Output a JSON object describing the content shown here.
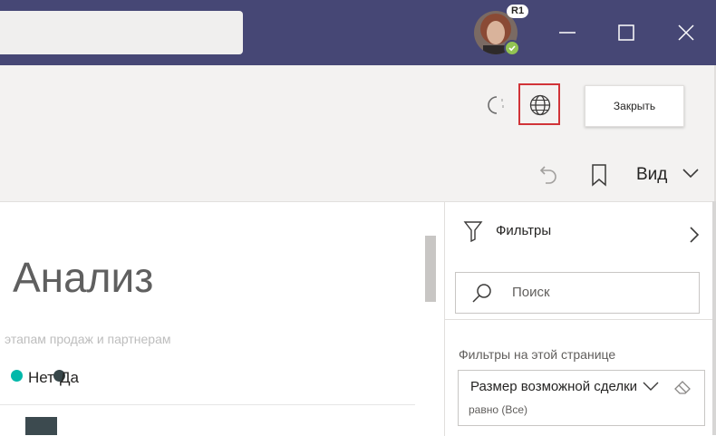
{
  "titlebar": {
    "user_badge": "R1",
    "presence_status": "available",
    "colors": {
      "background": "#464775",
      "search": "#f0efee",
      "presence": "#92c353"
    },
    "window_icons": [
      "minimize-icon",
      "maximize-icon",
      "close-icon"
    ]
  },
  "toolbar": {
    "refresh_icon": "refresh-icon",
    "globe_icon": "globe-icon",
    "close_label": "Закрыть",
    "undo_icon": "undo-icon",
    "bookmark_icon": "bookmark-icon",
    "view_label": "Вид",
    "highlight_color": "#d13438"
  },
  "report": {
    "title": "Анализ",
    "subtitle": "этапам продаж и партнерам",
    "legend": [
      {
        "label": "Нет",
        "color": "#01b8aa"
      },
      {
        "label": "Да",
        "color": "#374649"
      }
    ]
  },
  "filters": {
    "title": "Фильтры",
    "search_placeholder": "Поиск",
    "section_title": "Фильтры на этой странице",
    "cards": [
      {
        "name": "Размер возможной сделки",
        "value": "равно (Все)"
      }
    ]
  }
}
